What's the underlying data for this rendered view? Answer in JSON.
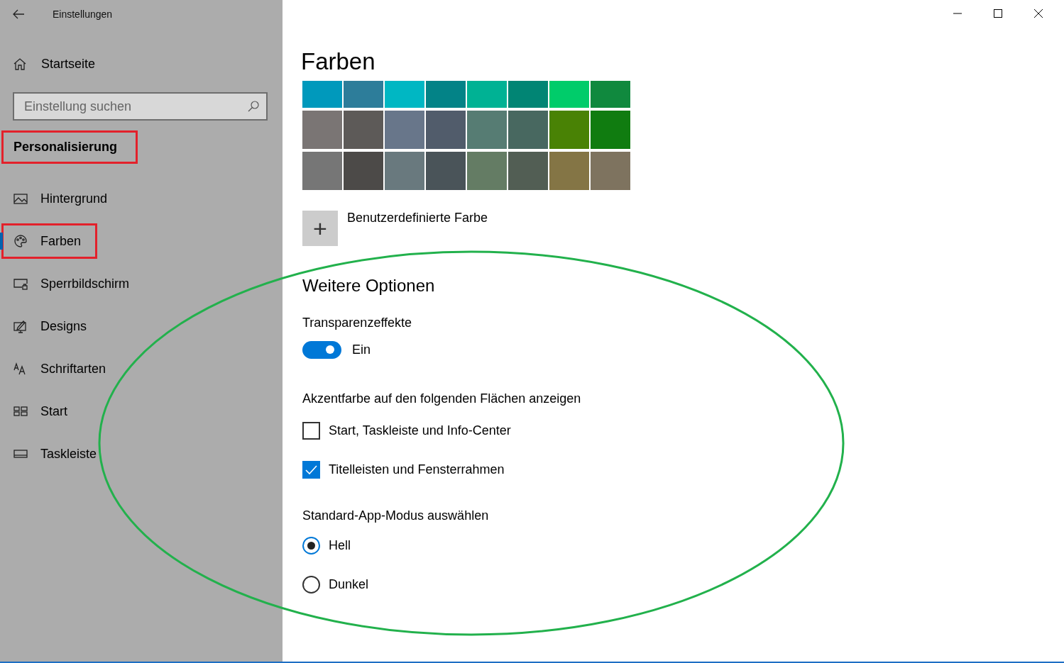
{
  "window": {
    "title": "Einstellungen"
  },
  "sidebar": {
    "home": "Startseite",
    "search": {
      "placeholder": "Einstellung suchen"
    },
    "section": {
      "label": "Personalisierung",
      "highlighted": true
    },
    "items": [
      {
        "label": "Hintergrund",
        "selected": false,
        "highlighted": false
      },
      {
        "label": "Farben",
        "selected": true,
        "highlighted": true
      },
      {
        "label": "Sperrbildschirm",
        "selected": false,
        "highlighted": false
      },
      {
        "label": "Designs",
        "selected": false,
        "highlighted": false
      },
      {
        "label": "Schriftarten",
        "selected": false,
        "highlighted": false
      },
      {
        "label": "Start",
        "selected": false,
        "highlighted": false
      },
      {
        "label": "Taskleiste",
        "selected": false,
        "highlighted": false
      }
    ]
  },
  "main": {
    "title": "Farben",
    "swatches": [
      {
        "color": "#0099bc"
      },
      {
        "color": "#2d7d9a"
      },
      {
        "color": "#00b7c3"
      },
      {
        "color": "#038387"
      },
      {
        "color": "#00b294"
      },
      {
        "color": "#018574"
      },
      {
        "color": "#00cc6a"
      },
      {
        "color": "#10893e"
      },
      {
        "color": "#7a7574"
      },
      {
        "color": "#5d5a58"
      },
      {
        "color": "#68768a"
      },
      {
        "color": "#515c6b"
      },
      {
        "color": "#567c73"
      },
      {
        "color": "#486860"
      },
      {
        "color": "#498205"
      },
      {
        "color": "#107c10"
      },
      {
        "color": "#767676"
      },
      {
        "color": "#4c4a48"
      },
      {
        "color": "#69797e"
      },
      {
        "color": "#4a5459"
      },
      {
        "color": "#647c64"
      },
      {
        "color": "#525e54"
      },
      {
        "color": "#847545"
      },
      {
        "color": "#7e735f"
      }
    ],
    "custom_color": {
      "button": "+",
      "label": "Benutzerdefinierte Farbe"
    },
    "more_options": {
      "title": "Weitere Optionen",
      "transparency": {
        "label": "Transparenzeffekte",
        "on": true,
        "state_label": "Ein"
      },
      "accent_heading": "Akzentfarbe auf den folgenden Flächen anzeigen",
      "accent_options": [
        {
          "label": "Start, Taskleiste und Info-Center",
          "checked": false
        },
        {
          "label": "Titelleisten und Fensterrahmen",
          "checked": true
        }
      ],
      "mode_heading": "Standard-App-Modus auswählen",
      "modes": [
        {
          "label": "Hell",
          "selected": true
        },
        {
          "label": "Dunkel",
          "selected": false
        }
      ]
    }
  }
}
